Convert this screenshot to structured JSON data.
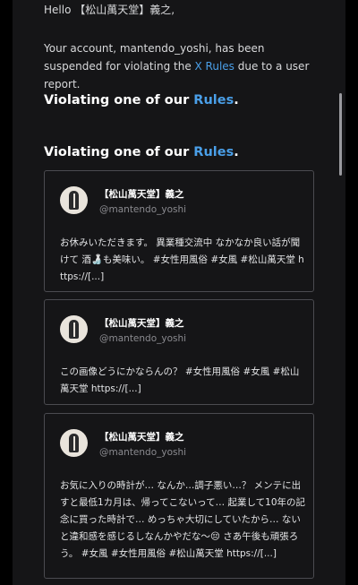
{
  "email": {
    "greeting": "Hello 【松山萬天堂】義之,",
    "notice_before": "Your account, mantendo_yoshi, has been suspended for violating the ",
    "notice_link": "X Rules",
    "notice_after": " due to a user report.",
    "heading_prefix": "Violating one of our ",
    "heading_link": "Rules",
    "heading_suffix": ".",
    "colors": {
      "background": "#151517",
      "link": "#4a9fe8",
      "card_border": "#4b4b50"
    }
  },
  "posts": [
    {
      "author_name": "【松山萬天堂】義之",
      "author_handle": "@mantendo_yoshi",
      "text": "お休みいただきます。 異業種交流中 なかなか良い話が聞けて 酒🍶も美味い。 #女性用風俗 #女風 #松山萬天堂 https://[...]"
    },
    {
      "author_name": "【松山萬天堂】義之",
      "author_handle": "@mantendo_yoshi",
      "text": "この画像どうにかならんの？ #女性用風俗 #女風 #松山萬天堂 https://[...]"
    },
    {
      "author_name": "【松山萬天堂】義之",
      "author_handle": "@mantendo_yoshi",
      "text": "お気に入りの時計が… なんか…調子悪い…？ メンテに出すと最低1カ月は、帰ってこないって… 起業して10年の記念に買った時計で… めっちゃ大切にしていたから… ないと違和感を感じるしなんかやだな～😔 さあ午後も頑張ろう。 #女風 #女性用風俗 #松山萬天堂 https://[...]"
    }
  ]
}
